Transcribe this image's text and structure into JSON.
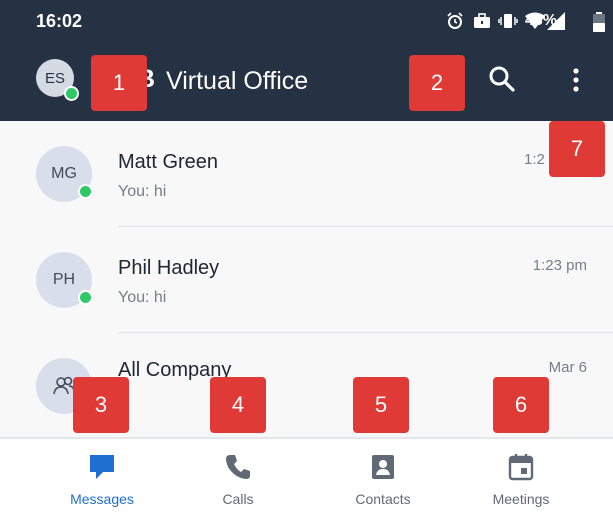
{
  "status_bar": {
    "time": "16:02",
    "battery": "43%"
  },
  "app_bar": {
    "avatar_initials": "ES",
    "title_fragment": "B",
    "title": "Virtual Office",
    "accent_color": "#253243"
  },
  "conversations": [
    {
      "initials": "MG",
      "name": "Matt Green",
      "preview": "You: hi",
      "time": "1:2",
      "online": true
    },
    {
      "initials": "PH",
      "name": "Phil Hadley",
      "preview": "You: hi",
      "time": "1:23 pm",
      "online": true
    },
    {
      "initials": "",
      "name": "All Company",
      "preview": "",
      "time": "Mar 6",
      "online": false,
      "icon": "group-icon"
    }
  ],
  "bottom_nav": [
    {
      "label": "Messages",
      "icon": "message-icon",
      "active": true
    },
    {
      "label": "Calls",
      "icon": "phone-icon",
      "active": false
    },
    {
      "label": "Contacts",
      "icon": "contact-card-icon",
      "active": false
    },
    {
      "label": "Meetings",
      "icon": "calendar-icon",
      "active": false
    }
  ],
  "markers": [
    "1",
    "2",
    "3",
    "4",
    "5",
    "6",
    "7"
  ],
  "colors": {
    "header": "#253243",
    "active_tab": "#1f6fd1",
    "presence_online": "#2ec865",
    "marker": "#e03a37"
  }
}
